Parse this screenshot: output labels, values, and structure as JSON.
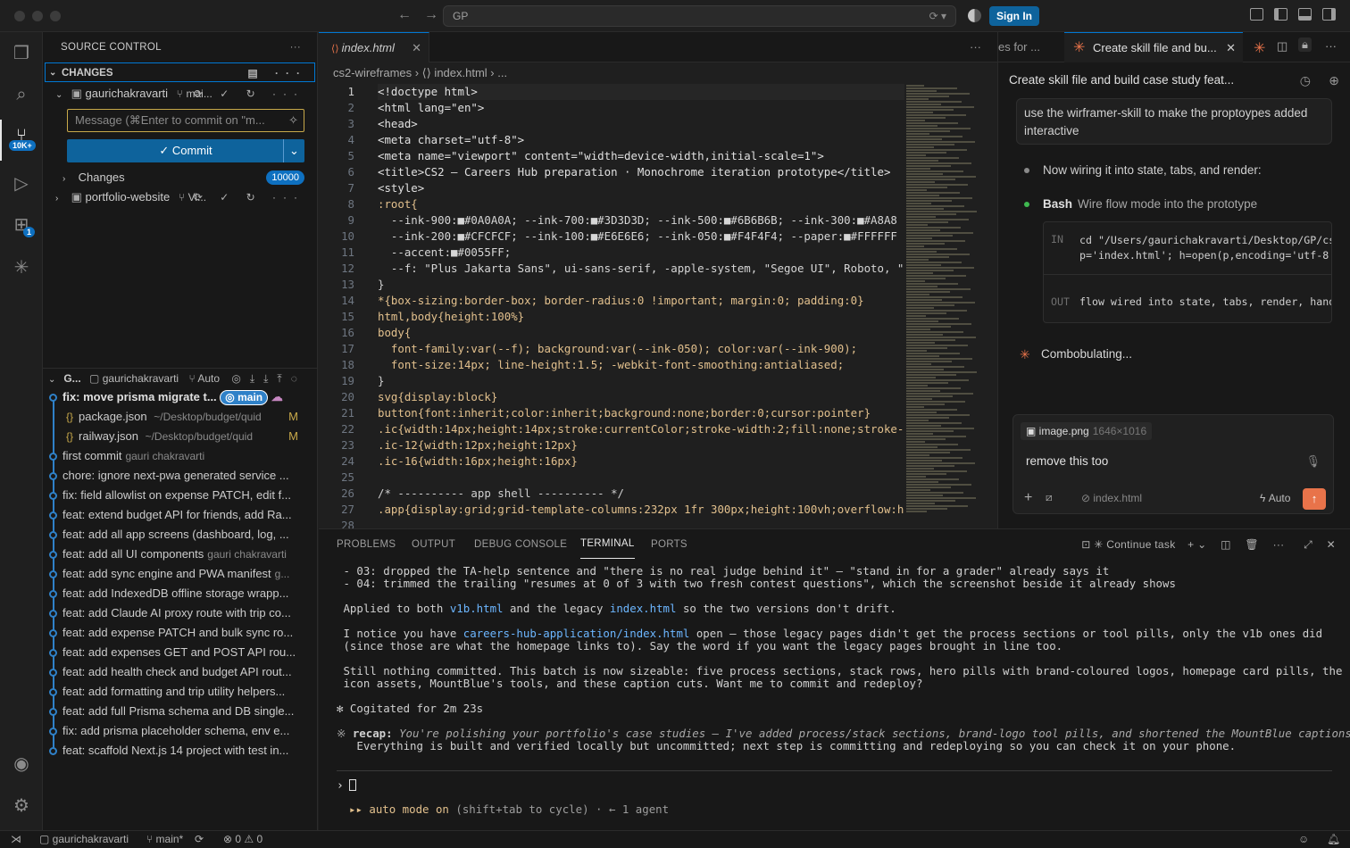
{
  "titlebar": {
    "search": "GP",
    "sign_in": "Sign In"
  },
  "activity": {
    "scm_badge": "10K+",
    "ext_badge": "1"
  },
  "sidebar": {
    "title": "SOURCE CONTROL",
    "changes_label": "CHANGES",
    "repo1": {
      "name": "gaurichakravarti",
      "branch": "mai..."
    },
    "message_placeholder": "Message (⌘Enter to commit on \"m...",
    "commit_label": "Commit",
    "changes_group": "Changes",
    "changes_count": "10000",
    "repo2": {
      "name": "portfolio-website",
      "branch": "Vi..."
    },
    "graph_header": {
      "label": "G...",
      "user": "gaurichakravarti",
      "branch": "Auto"
    },
    "graph": [
      {
        "msg": "fix: move prisma migrate t...",
        "tag": "main"
      },
      {
        "file": "package.json",
        "path": "~/Desktop/budget/quid",
        "status": "M"
      },
      {
        "file": "railway.json",
        "path": "~/Desktop/budget/quid",
        "status": "M"
      },
      {
        "msg": "first commit",
        "author": "gauri chakravarti"
      },
      {
        "msg": "chore: ignore next-pwa generated service ..."
      },
      {
        "msg": "fix: field allowlist on expense PATCH, edit f..."
      },
      {
        "msg": "feat: extend budget API for friends, add Ra..."
      },
      {
        "msg": "feat: add all app screens (dashboard, log, ..."
      },
      {
        "msg": "feat: add all UI components",
        "author": "gauri chakravarti"
      },
      {
        "msg": "feat: add sync engine and PWA manifest",
        "author": "g..."
      },
      {
        "msg": "feat: add IndexedDB offline storage wrapp..."
      },
      {
        "msg": "feat: add Claude AI proxy route with trip co..."
      },
      {
        "msg": "feat: add expense PATCH and bulk sync ro..."
      },
      {
        "msg": "feat: add expenses GET and POST API rou..."
      },
      {
        "msg": "feat: add health check and budget API rout..."
      },
      {
        "msg": "feat: add formatting and trip utility helpers..."
      },
      {
        "msg": "feat: add full Prisma schema and DB single..."
      },
      {
        "msg": "fix: add prisma placeholder schema, env e..."
      },
      {
        "msg": "feat: scaffold Next.js 14 project with test in..."
      }
    ]
  },
  "editor": {
    "tab": "index.html",
    "breadcrumb": "cs2-wireframes  ›  ⟨⟩ index.html  › ...",
    "lines": [
      "<!doctype html>",
      "<html lang=\"en\">",
      "<head>",
      "<meta charset=\"utf-8\">",
      "<meta name=\"viewport\" content=\"width=device-width,initial-scale=1\">",
      "<title>CS2 — Careers Hub preparation · Monochrome iteration prototype</title>",
      "<style>",
      ":root{",
      "  --ink-900:■#0A0A0A; --ink-700:■#3D3D3D; --ink-500:■#6B6B6B; --ink-300:■#A8A8",
      "  --ink-200:■#CFCFCF; --ink-100:■#E6E6E6; --ink-050:■#F4F4F4; --paper:■#FFFFFF",
      "  --accent:■#0055FF;",
      "  --f: \"Plus Jakarta Sans\", ui-sans-serif, -apple-system, \"Segoe UI\", Roboto, \"Hel",
      "}",
      "*{box-sizing:border-box; border-radius:0 !important; margin:0; padding:0}",
      "html,body{height:100%}",
      "body{",
      "  font-family:var(--f); background:var(--ink-050); color:var(--ink-900);",
      "  font-size:14px; line-height:1.5; -webkit-font-smoothing:antialiased;",
      "}",
      "svg{display:block}",
      "button{font:inherit;color:inherit;background:none;border:0;cursor:pointer}",
      ".ic{width:14px;height:14px;stroke:currentColor;stroke-width:2;fill:none;stroke-lin",
      ".ic-12{width:12px;height:12px}",
      ".ic-16{width:16px;height:16px}",
      "",
      "/* ---------- app shell ---------- */",
      ".app{display:grid;grid-template-columns:232px 1fr 300px;height:100vh;overflow:hidd",
      ""
    ]
  },
  "chat": {
    "prev_tab": "es for ...",
    "tab": "Create skill file and bu...",
    "title": "Create skill file and build case study feat...",
    "user_msg": "use the wirframer-skill to make the proptoypes added interactive",
    "step1": "Now wiring it into state, tabs, and render:",
    "bash_label": "Bash",
    "bash_desc": "Wire flow mode into the prototype",
    "in_label": "IN",
    "in_text": "cd \"/Users/gaurichakravarti/Desktop/GP/cs1\np='index.html'; h=open(p,encoding='utf-8')",
    "out_label": "OUT",
    "out_text": "flow wired into state, tabs, render, handl",
    "status": "Combobulating...",
    "attachment": "image.png",
    "attachment_size": "1646×1016",
    "input": "remove this too",
    "context": "index.html",
    "mode": "Auto"
  },
  "panel": {
    "tabs": [
      "PROBLEMS",
      "OUTPUT",
      "DEBUG CONSOLE",
      "TERMINAL",
      "PORTS"
    ],
    "task": "Continue task",
    "term": {
      "l1": " - 03: dropped the TA-help sentence and \"there is no real judge behind it\" — \"stand in for a grader\" already says it",
      "l2": " - 04: trimmed the trailing \"resumes at 0 of 3 with two fresh contest questions\", which the screenshot beside it already shows",
      "l3a": " Applied to both ",
      "l3b": "v1b.html",
      "l3c": " and the legacy ",
      "l3d": "index.html",
      "l3e": " so the two versions don't drift.",
      "l4a": " I notice you have ",
      "l4b": "careers-hub-application/index.html",
      "l4c": " open — those legacy pages didn't get the process sections or tool pills, only the v1b ones did",
      "l5": " (since those are what the homepage links to). Say the word if you want the legacy pages brought in line too.",
      "l6": " Still nothing committed. This batch is now sizeable: five process sections, stack rows, hero pills with brand-coloured logos, homepage card pills, the",
      "l7": " icon assets, MountBlue's tools, and these caption cuts. Want me to commit and redeploy?",
      "l8": "✻ Cogitated for 2m 23s",
      "l9a": "※ ",
      "l9b": "recap:",
      "l9c": " You're polishing your portfolio's case studies — I've added process/stack sections, brand-logo tool pills, and shortened the MountBlue captions.",
      "l10": "   Everything is built and verified locally but uncommitted; next step is committing and redeploying so you can check it on your phone.",
      "prompt": "›",
      "mode_a": "▸▸ auto mode on",
      "mode_b": " (shift+tab to cycle) · ← 1 agent"
    }
  },
  "status": {
    "user": "gaurichakravarti",
    "branch": "main*",
    "errors": "0",
    "warnings": "0"
  }
}
